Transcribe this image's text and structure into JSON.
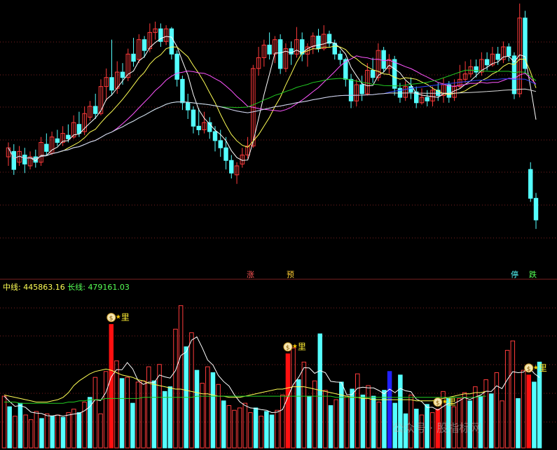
{
  "colors": {
    "up": "#ff3b3b",
    "down": "#54ffff",
    "ma_white": "#ffffff",
    "ma_yellow": "#ffff55",
    "ma_magenta": "#ff55ff",
    "ma_green": "#22cc22",
    "ma_blue": "#3344ff",
    "ma_slow": "#dddddd",
    "grid": "#7a1f1f",
    "signal_bar": "#ff1010",
    "volume_special": "#2222ff",
    "tag_zhang": "#ff5555",
    "tag_yu": "#ffcc33",
    "tag_ting": "#55ffff",
    "tag_die": "#55ff55",
    "legend_mid": "#ffff55",
    "legend_long": "#55ff55"
  },
  "tags": {
    "zhang": "涨",
    "yu": "预",
    "ting": "停",
    "die": "跌"
  },
  "legend": {
    "mid_label": "中线:",
    "mid_value": "445863.16",
    "long_label": "长线:",
    "long_value": "479161.03"
  },
  "signal_label": "里",
  "signal_icon": "money-bag-icon",
  "watermark": "公众号 · 股指标网",
  "chart_data": [
    {
      "type": "candlestick",
      "series": [
        {
          "o": 175,
          "c": 180,
          "h": 183,
          "l": 170
        },
        {
          "o": 178,
          "c": 168,
          "h": 182,
          "l": 165
        },
        {
          "o": 172,
          "c": 178,
          "h": 181,
          "l": 170
        },
        {
          "o": 176,
          "c": 171,
          "h": 180,
          "l": 166
        },
        {
          "o": 170,
          "c": 175,
          "h": 178,
          "l": 168
        },
        {
          "o": 175,
          "c": 172,
          "h": 179,
          "l": 169
        },
        {
          "o": 172,
          "c": 183,
          "h": 186,
          "l": 170
        },
        {
          "o": 182,
          "c": 178,
          "h": 188,
          "l": 176
        },
        {
          "o": 177,
          "c": 186,
          "h": 189,
          "l": 176
        },
        {
          "o": 185,
          "c": 183,
          "h": 190,
          "l": 181
        },
        {
          "o": 183,
          "c": 188,
          "h": 192,
          "l": 181
        },
        {
          "o": 187,
          "c": 185,
          "h": 193,
          "l": 183
        },
        {
          "o": 186,
          "c": 194,
          "h": 198,
          "l": 185
        },
        {
          "o": 193,
          "c": 188,
          "h": 200,
          "l": 186
        },
        {
          "o": 189,
          "c": 199,
          "h": 203,
          "l": 187
        },
        {
          "o": 197,
          "c": 203,
          "h": 206,
          "l": 195
        },
        {
          "o": 203,
          "c": 199,
          "h": 210,
          "l": 196
        },
        {
          "o": 199,
          "c": 214,
          "h": 218,
          "l": 198
        },
        {
          "o": 214,
          "c": 219,
          "h": 224,
          "l": 206
        },
        {
          "o": 219,
          "c": 212,
          "h": 240,
          "l": 209
        },
        {
          "o": 213,
          "c": 222,
          "h": 228,
          "l": 210
        },
        {
          "o": 222,
          "c": 219,
          "h": 227,
          "l": 215
        },
        {
          "o": 219,
          "c": 232,
          "h": 235,
          "l": 217
        },
        {
          "o": 232,
          "c": 228,
          "h": 241,
          "l": 225
        },
        {
          "o": 229,
          "c": 240,
          "h": 243,
          "l": 227
        },
        {
          "o": 240,
          "c": 234,
          "h": 242,
          "l": 230
        },
        {
          "o": 235,
          "c": 244,
          "h": 249,
          "l": 233
        },
        {
          "o": 244,
          "c": 246,
          "h": 250,
          "l": 240
        },
        {
          "o": 246,
          "c": 239,
          "h": 249,
          "l": 236
        },
        {
          "o": 239,
          "c": 246,
          "h": 248,
          "l": 237
        },
        {
          "o": 246,
          "c": 232,
          "h": 247,
          "l": 229
        },
        {
          "o": 232,
          "c": 218,
          "h": 234,
          "l": 214
        },
        {
          "o": 218,
          "c": 205,
          "h": 220,
          "l": 201
        },
        {
          "o": 205,
          "c": 201,
          "h": 210,
          "l": 196
        },
        {
          "o": 201,
          "c": 192,
          "h": 203,
          "l": 188
        },
        {
          "o": 192,
          "c": 190,
          "h": 202,
          "l": 187
        },
        {
          "o": 190,
          "c": 194,
          "h": 200,
          "l": 188
        },
        {
          "o": 194,
          "c": 189,
          "h": 197,
          "l": 185
        },
        {
          "o": 189,
          "c": 184,
          "h": 192,
          "l": 178
        },
        {
          "o": 184,
          "c": 180,
          "h": 190,
          "l": 175
        },
        {
          "o": 180,
          "c": 173,
          "h": 186,
          "l": 168
        },
        {
          "o": 173,
          "c": 166,
          "h": 176,
          "l": 163
        },
        {
          "o": 165,
          "c": 170,
          "h": 172,
          "l": 160
        },
        {
          "o": 171,
          "c": 176,
          "h": 180,
          "l": 169
        },
        {
          "o": 176,
          "c": 181,
          "h": 186,
          "l": 174
        },
        {
          "o": 181,
          "c": 224,
          "h": 226,
          "l": 180
        },
        {
          "o": 224,
          "c": 230,
          "h": 236,
          "l": 220
        },
        {
          "o": 230,
          "c": 237,
          "h": 240,
          "l": 225
        },
        {
          "o": 237,
          "c": 232,
          "h": 244,
          "l": 229
        },
        {
          "o": 232,
          "c": 240,
          "h": 242,
          "l": 227
        },
        {
          "o": 240,
          "c": 224,
          "h": 243,
          "l": 221
        },
        {
          "o": 224,
          "c": 235,
          "h": 238,
          "l": 222
        },
        {
          "o": 235,
          "c": 232,
          "h": 239,
          "l": 226
        },
        {
          "o": 232,
          "c": 240,
          "h": 247,
          "l": 230
        },
        {
          "o": 240,
          "c": 232,
          "h": 244,
          "l": 228
        },
        {
          "o": 232,
          "c": 236,
          "h": 238,
          "l": 225
        },
        {
          "o": 236,
          "c": 242,
          "h": 244,
          "l": 232
        },
        {
          "o": 242,
          "c": 235,
          "h": 246,
          "l": 233
        },
        {
          "o": 235,
          "c": 243,
          "h": 248,
          "l": 234
        },
        {
          "o": 243,
          "c": 238,
          "h": 245,
          "l": 236
        },
        {
          "o": 238,
          "c": 232,
          "h": 240,
          "l": 229
        },
        {
          "o": 232,
          "c": 229,
          "h": 234,
          "l": 226
        },
        {
          "o": 229,
          "c": 218,
          "h": 230,
          "l": 214
        },
        {
          "o": 218,
          "c": 206,
          "h": 221,
          "l": 202
        },
        {
          "o": 206,
          "c": 215,
          "h": 218,
          "l": 203
        },
        {
          "o": 215,
          "c": 210,
          "h": 220,
          "l": 206
        },
        {
          "o": 210,
          "c": 223,
          "h": 227,
          "l": 209
        },
        {
          "o": 223,
          "c": 219,
          "h": 230,
          "l": 216
        },
        {
          "o": 219,
          "c": 234,
          "h": 238,
          "l": 217
        },
        {
          "o": 234,
          "c": 224,
          "h": 236,
          "l": 222
        },
        {
          "o": 224,
          "c": 229,
          "h": 232,
          "l": 221
        },
        {
          "o": 229,
          "c": 213,
          "h": 231,
          "l": 209
        },
        {
          "o": 213,
          "c": 208,
          "h": 216,
          "l": 205
        },
        {
          "o": 208,
          "c": 214,
          "h": 217,
          "l": 206
        },
        {
          "o": 214,
          "c": 211,
          "h": 219,
          "l": 207
        },
        {
          "o": 211,
          "c": 205,
          "h": 214,
          "l": 202
        },
        {
          "o": 205,
          "c": 208,
          "h": 213,
          "l": 204
        },
        {
          "o": 208,
          "c": 206,
          "h": 212,
          "l": 203
        },
        {
          "o": 206,
          "c": 212,
          "h": 214,
          "l": 203
        },
        {
          "o": 212,
          "c": 209,
          "h": 216,
          "l": 206
        },
        {
          "o": 209,
          "c": 215,
          "h": 219,
          "l": 205
        },
        {
          "o": 215,
          "c": 208,
          "h": 217,
          "l": 205
        },
        {
          "o": 208,
          "c": 214,
          "h": 218,
          "l": 206
        },
        {
          "o": 214,
          "c": 218,
          "h": 226,
          "l": 213
        },
        {
          "o": 218,
          "c": 221,
          "h": 228,
          "l": 216
        },
        {
          "o": 221,
          "c": 225,
          "h": 229,
          "l": 219
        },
        {
          "o": 225,
          "c": 222,
          "h": 229,
          "l": 219
        },
        {
          "o": 222,
          "c": 229,
          "h": 233,
          "l": 220
        },
        {
          "o": 229,
          "c": 226,
          "h": 233,
          "l": 223
        },
        {
          "o": 226,
          "c": 232,
          "h": 236,
          "l": 225
        },
        {
          "o": 232,
          "c": 229,
          "h": 236,
          "l": 226
        },
        {
          "o": 229,
          "c": 236,
          "h": 239,
          "l": 227
        },
        {
          "o": 236,
          "c": 231,
          "h": 238,
          "l": 228
        },
        {
          "o": 231,
          "c": 210,
          "h": 233,
          "l": 207
        },
        {
          "o": 210,
          "c": 252,
          "h": 260,
          "l": 208
        },
        {
          "o": 252,
          "c": 224,
          "h": 256,
          "l": 221
        },
        {
          "o": 168,
          "c": 152,
          "h": 172,
          "l": 150
        },
        {
          "o": 152,
          "c": 140,
          "h": 155,
          "l": 135
        }
      ]
    },
    {
      "type": "bar",
      "name_mid": "中线",
      "name_long": "长线",
      "mid_last": 445863.16,
      "long_last": 479161.03,
      "volume": [
        44,
        35,
        27,
        38,
        28,
        24,
        31,
        25,
        29,
        27,
        28,
        26,
        30,
        33,
        30,
        39,
        43,
        60,
        29,
        65,
        105,
        74,
        59,
        60,
        38,
        56,
        57,
        69,
        57,
        71,
        48,
        52,
        101,
        121,
        86,
        98,
        66,
        55,
        69,
        64,
        54,
        40,
        36,
        32,
        34,
        38,
        30,
        34,
        27,
        31,
        28,
        32,
        45,
        80,
        85,
        58,
        73,
        44,
        57,
        97,
        49,
        36,
        41,
        56,
        44,
        50,
        63,
        45,
        53,
        44,
        39,
        49,
        65,
        38,
        62,
        29,
        45,
        33,
        28,
        37,
        30,
        33,
        48,
        42,
        35,
        42,
        47,
        40,
        52,
        44,
        58,
        46,
        64,
        40,
        83,
        91,
        42,
        66,
        62,
        56,
        73
      ],
      "volume_up": [
        1,
        0,
        1,
        0,
        1,
        1,
        1,
        0,
        1,
        0,
        1,
        0,
        1,
        1,
        0,
        1,
        0,
        1,
        1,
        1,
        1,
        1,
        0,
        1,
        0,
        1,
        1,
        1,
        0,
        1,
        0,
        0,
        1,
        1,
        0,
        1,
        0,
        1,
        1,
        0,
        1,
        0,
        1,
        1,
        1,
        1,
        1,
        0,
        1,
        0,
        0,
        1,
        1,
        1,
        1,
        0,
        1,
        0,
        1,
        0,
        1,
        0,
        1,
        0,
        1,
        0,
        1,
        0,
        1,
        0,
        1,
        0,
        1,
        0,
        0,
        0,
        1,
        0,
        1,
        0,
        1,
        0,
        1,
        0,
        1,
        1,
        1,
        0,
        1,
        0,
        1,
        0,
        1,
        1,
        1,
        1,
        0,
        1,
        1,
        0,
        0
      ],
      "signals": [
        20,
        53,
        81,
        98
      ],
      "special_blue": [
        72
      ],
      "ma_mid": [
        45,
        44,
        43,
        42,
        41,
        40,
        39,
        39,
        39,
        40,
        41,
        43,
        47,
        53,
        57,
        60,
        63,
        65,
        66,
        67,
        66,
        64,
        62,
        61,
        60,
        58,
        57,
        55,
        54,
        53,
        52,
        51,
        50,
        50,
        49,
        48,
        47,
        46,
        46,
        45,
        44,
        44,
        43,
        43,
        43,
        44,
        45,
        46,
        47,
        48,
        49,
        50,
        50,
        51,
        52,
        52,
        52,
        51,
        50,
        49,
        48,
        47,
        46,
        45,
        44,
        43,
        43,
        42,
        42,
        41,
        41,
        41,
        41,
        41,
        41,
        41,
        41,
        40,
        40,
        40,
        40,
        41,
        42,
        43,
        44,
        45,
        46,
        46,
        47,
        47,
        48
      ],
      "ma_long": [
        39,
        39,
        39,
        38,
        38,
        38,
        38,
        38,
        38,
        38,
        38,
        38,
        39,
        39,
        40,
        40,
        41,
        41,
        41,
        42,
        42,
        42,
        42,
        42,
        42,
        42,
        43,
        43,
        43,
        43,
        43,
        43,
        43,
        43,
        43,
        43,
        44,
        44,
        44,
        44,
        44,
        44,
        44,
        44,
        44,
        44,
        44,
        44,
        44,
        44,
        44,
        44,
        44,
        44,
        44,
        44,
        44,
        44,
        44,
        44,
        44,
        44,
        43,
        43,
        43,
        43,
        43,
        43,
        43,
        43,
        43,
        43,
        43,
        43,
        43,
        43,
        43,
        43,
        43,
        43,
        43,
        43,
        43,
        43,
        43,
        43,
        43,
        43,
        43,
        44,
        44
      ]
    }
  ]
}
